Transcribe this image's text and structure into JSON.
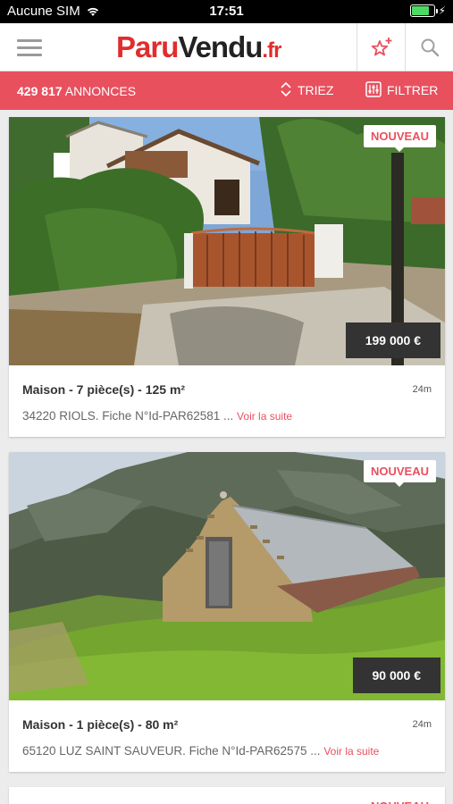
{
  "status_bar": {
    "carrier": "Aucune SIM",
    "time": "17:51"
  },
  "header": {
    "logo_part1": "Paru",
    "logo_part2": "Vendu",
    "logo_tld": ".fr",
    "menu_icon": "hamburger-menu-icon",
    "favorites_icon": "star-sparkle-icon",
    "search_icon": "search-icon"
  },
  "toolbar": {
    "count": "429 817",
    "count_label": "ANNONCES",
    "sort_label": "TRIEZ",
    "filter_label": "FILTRER",
    "background": "#e8505e"
  },
  "listings": [
    {
      "badge": "NOUVEAU",
      "price": "199 000 €",
      "title": "Maison - 7 pièce(s) - 125 m²",
      "age": "24m",
      "description": "34220 RIOLS. Fiche N°Id-PAR62581 ...",
      "more": "Voir la suite"
    },
    {
      "badge": "NOUVEAU",
      "price": "90 000 €",
      "title": "Maison - 1 pièce(s) - 80 m²",
      "age": "24m",
      "description": "65120 LUZ SAINT SAUVEUR. Fiche N°Id-PAR62575 ...",
      "more": "Voir la suite"
    },
    {
      "badge": "NOUVEAU"
    }
  ]
}
